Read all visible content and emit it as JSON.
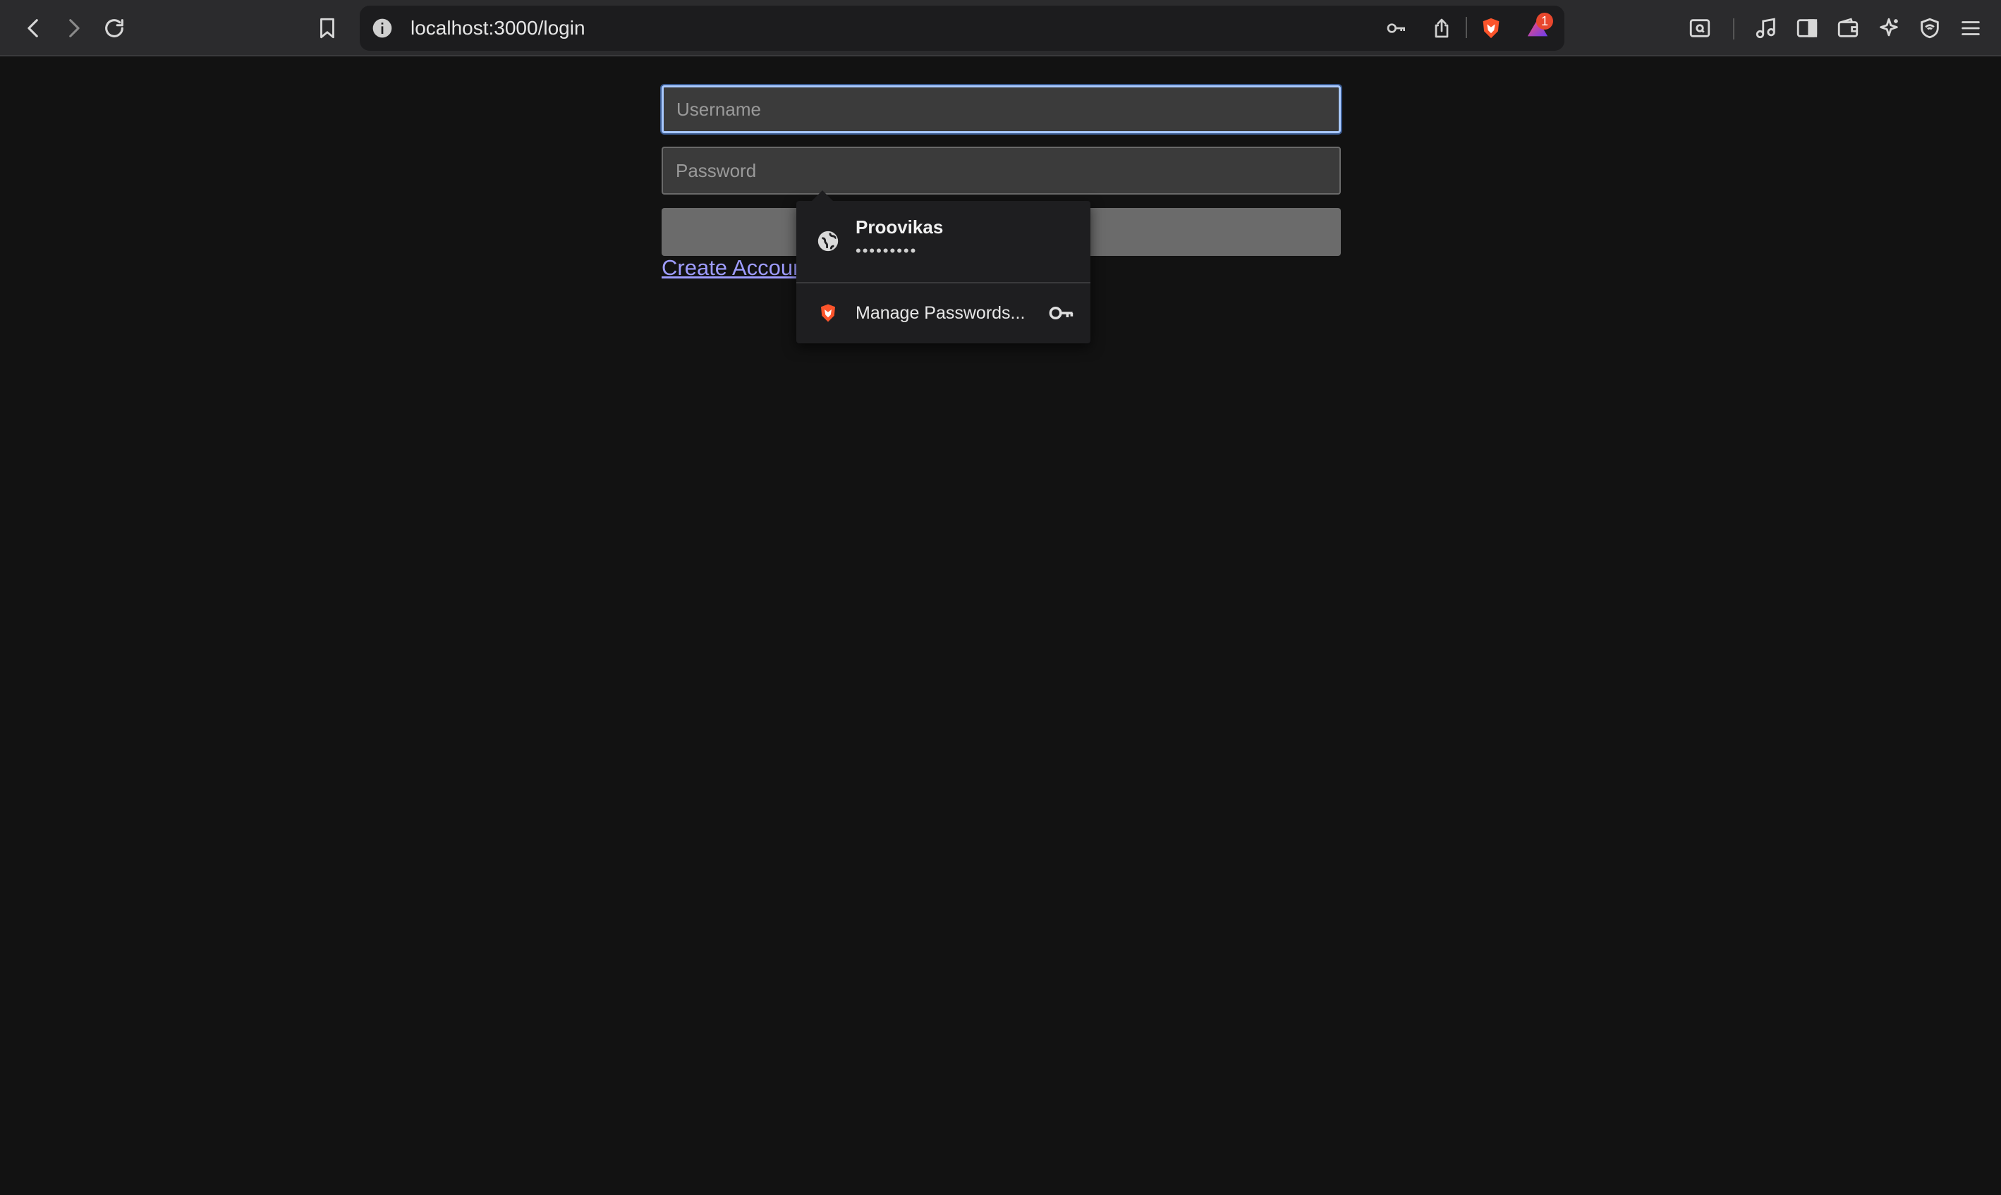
{
  "browser": {
    "url": "localhost:3000/login",
    "notification_count": "1"
  },
  "login_form": {
    "username_placeholder": "Username",
    "password_placeholder": "Password",
    "create_account_link": "Create Account"
  },
  "autofill_popup": {
    "saved_username": "Proovikas",
    "saved_password_mask": "•••••••••",
    "manage_passwords_label": "Manage Passwords..."
  },
  "colors": {
    "page_background": "#121212",
    "toolbar_background": "#2b2b2d",
    "link": "#9e9cff",
    "focus_ring": "#a9c9ff",
    "brave_orange": "#fb542b"
  }
}
